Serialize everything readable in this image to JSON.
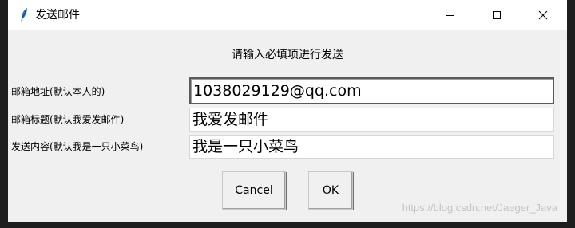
{
  "window": {
    "title": "发送邮件",
    "icon": "feather-icon",
    "controls": [
      "minimize-icon",
      "maximize-icon",
      "close-icon"
    ]
  },
  "form": {
    "heading": "请输入必填项进行发送",
    "fields": [
      {
        "label": "邮箱地址(默认本人的)",
        "value": "1038029129@qq.com"
      },
      {
        "label": "邮箱标题(默认我爱发邮件)",
        "value": "我爱发邮件"
      },
      {
        "label": "发送内容(默认我是一只小菜鸟)",
        "value": "我是一只小菜鸟"
      }
    ]
  },
  "buttons": {
    "cancel": "Cancel",
    "ok": "OK"
  },
  "watermark": "https://blog.csdn.net/Jaeger_Java"
}
